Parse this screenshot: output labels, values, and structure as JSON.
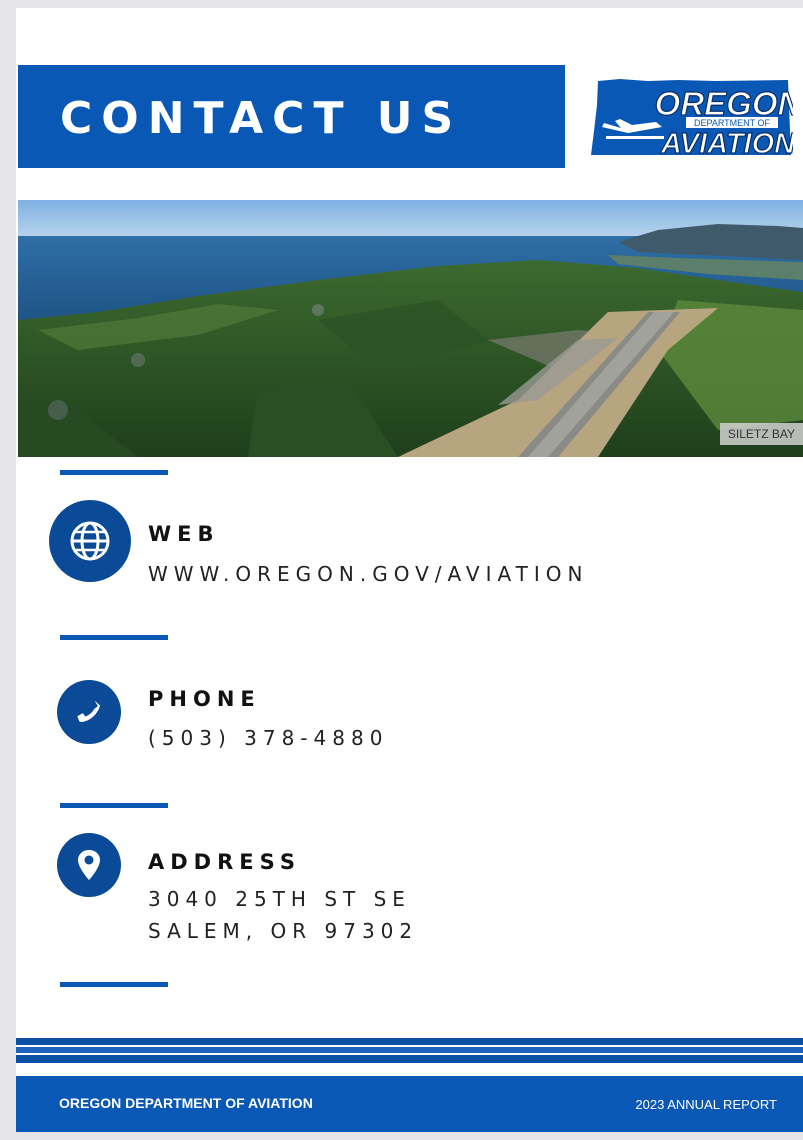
{
  "header": {
    "title": "CONTACT US",
    "logo": {
      "line1": "OREGON",
      "line2": "DEPARTMENT OF",
      "line3": "AVIATION",
      "icon": "oregon-state-airplane-logo"
    }
  },
  "photo": {
    "caption": "SILETZ BAY"
  },
  "contacts": {
    "web": {
      "label": "WEB",
      "value": "WWW.OREGON.GOV/AVIATION",
      "icon": "globe-icon"
    },
    "phone": {
      "label": "PHONE",
      "value": "(503) 378-4880",
      "icon": "phone-icon"
    },
    "address": {
      "label": "ADDRESS",
      "line1": "3040 25TH ST SE",
      "line2": "SALEM, OR 97302",
      "icon": "map-pin-icon"
    }
  },
  "footer": {
    "left": "OREGON DEPARTMENT OF AVIATION",
    "right": "2023 ANNUAL REPORT"
  },
  "colors": {
    "brand_blue": "#0a58b5",
    "icon_blue": "#0b4a97"
  }
}
